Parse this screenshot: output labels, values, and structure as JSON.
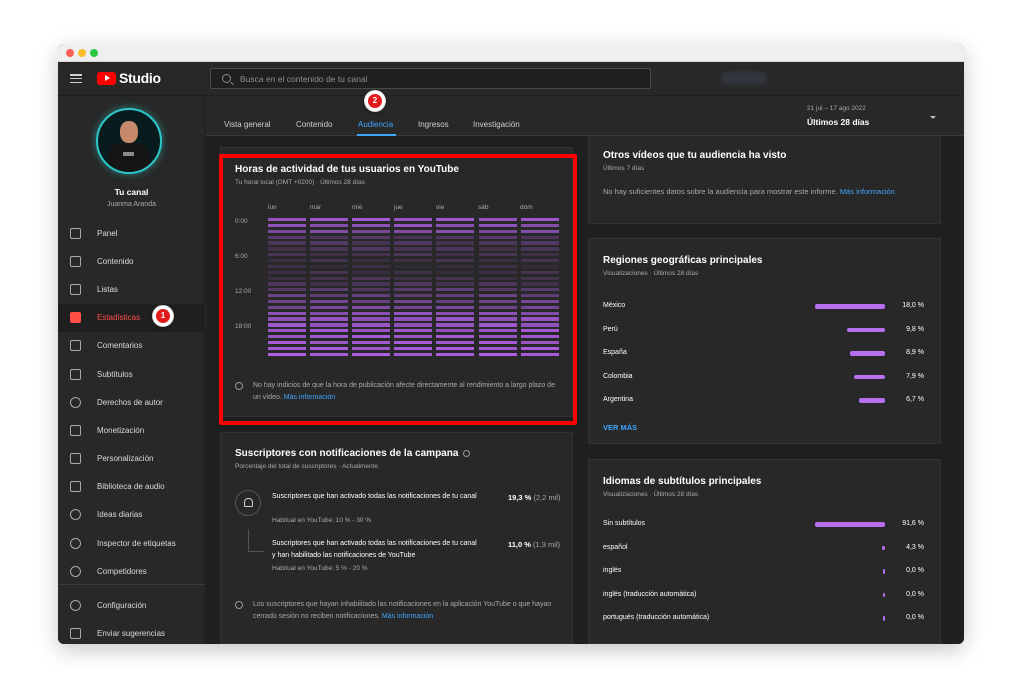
{
  "app": {
    "logo_text": "Studio"
  },
  "search": {
    "placeholder": "Busca en el contenido de tu canal"
  },
  "channel": {
    "label": "Tu canal",
    "name": "Juanma Aranda"
  },
  "sidebar": {
    "items": [
      {
        "label": "Panel",
        "icon": "dashboard-icon"
      },
      {
        "label": "Contenido",
        "icon": "video-library-icon"
      },
      {
        "label": "Listas",
        "icon": "playlist-icon"
      },
      {
        "label": "Estadísticas",
        "icon": "analytics-icon",
        "active": true
      },
      {
        "label": "Comentarios",
        "icon": "comment-icon"
      },
      {
        "label": "Subtítulos",
        "icon": "subtitles-icon"
      },
      {
        "label": "Derechos de autor",
        "icon": "copyright-icon"
      },
      {
        "label": "Monetización",
        "icon": "dollar-icon"
      },
      {
        "label": "Personalización",
        "icon": "magic-wand-icon"
      },
      {
        "label": "Biblioteca de audio",
        "icon": "audio-library-icon"
      },
      {
        "label": "Ideas diarias",
        "icon": "extension-icon"
      },
      {
        "label": "Inspector de etiquetas",
        "icon": "extension-icon"
      },
      {
        "label": "Competidores",
        "icon": "extension-icon"
      }
    ],
    "bottom_items": [
      {
        "label": "Configuración",
        "icon": "gear-icon"
      },
      {
        "label": "Enviar sugerencias",
        "icon": "feedback-icon"
      }
    ]
  },
  "tabs": [
    {
      "label": "Vista general"
    },
    {
      "label": "Contenido"
    },
    {
      "label": "Audiencia",
      "active": true
    },
    {
      "label": "Ingresos"
    },
    {
      "label": "Investigación"
    }
  ],
  "date": {
    "range": "21 jul – 17 ago 2022",
    "label": "Últimos 28 días"
  },
  "activity": {
    "title": "Horas de actividad de tus usuarios en YouTube",
    "subtitle": "Tu horal local (GMT +0200) · Últimos 28 días",
    "days": [
      "lun",
      "mar",
      "mié",
      "jue",
      "vie",
      "sáb",
      "dom"
    ],
    "times": [
      "0:00",
      "6:00",
      "12:00",
      "18:00"
    ],
    "info": "No hay indicios de que la hora de publicación afecte directamente al rendimiento a largo plazo de un vídeo.",
    "info_link": "Más información"
  },
  "subscribers": {
    "title": "Suscriptores con notificaciones de la campana",
    "subtitle": "Porcentaje del total de suscriptores · Actualmente",
    "rows": [
      {
        "text": "Suscriptores que han activado todas las notificaciones de tu canal",
        "pct": "19,3 %",
        "abs": "(2,2 mil)",
        "typical": "Habitual en YouTube: 10 % - 30 %"
      },
      {
        "text": "Suscriptores que han activado todas las notificaciones de tu canal y han habilitado las notificaciones de YouTube",
        "pct": "11,0 %",
        "abs": "(1,3 mil)",
        "typical": "Habitual en YouTube: 5 % - 20 %"
      }
    ],
    "info": "Los suscriptores que hayan inhabilitado las notificaciones en la aplicación YouTube o que hayan cerrado sesión no reciben notificaciones.",
    "info_link": "Más información"
  },
  "other_videos": {
    "title": "Otros vídeos que tu audiencia ha visto",
    "subtitle": "Últimos 7 días",
    "message": "No hay suficientes datos sobre la audiencia para mostrar este informe.",
    "link": "Más información"
  },
  "regions": {
    "title": "Regiones geográficas principales",
    "subtitle": "Visualizaciones · Últimos 28 días",
    "rows": [
      {
        "label": "México",
        "pct": "18,0 %",
        "value": 18.0
      },
      {
        "label": "Perú",
        "pct": "9,8 %",
        "value": 9.8
      },
      {
        "label": "España",
        "pct": "8,9 %",
        "value": 8.9
      },
      {
        "label": "Colombia",
        "pct": "7,9 %",
        "value": 7.9
      },
      {
        "label": "Argentina",
        "pct": "6,7 %",
        "value": 6.7
      }
    ],
    "more": "VER MÁS"
  },
  "languages": {
    "title": "Idiomas de subtítulos principales",
    "subtitle": "Visualizaciones · Últimos 28 días",
    "rows": [
      {
        "label": "Sin subtítulos",
        "pct": "91,6 %",
        "value": 91.6
      },
      {
        "label": "español",
        "pct": "4,3 %",
        "value": 4.3
      },
      {
        "label": "inglés",
        "pct": "0,0 %",
        "value": 0.0
      },
      {
        "label": "inglés (traducción automática)",
        "pct": "0,0 %",
        "value": 0.0
      },
      {
        "label": "portugués (traducción automática)",
        "pct": "0,0 %",
        "value": 0.0
      }
    ]
  },
  "annotations": [
    {
      "number": "1"
    },
    {
      "number": "2"
    }
  ],
  "colors": {
    "accent": "#3ea6ff",
    "bar": "#b76ff0",
    "heat": "#a142d4",
    "highlight": "#ff0000",
    "active_nav": "#ff4e45"
  }
}
